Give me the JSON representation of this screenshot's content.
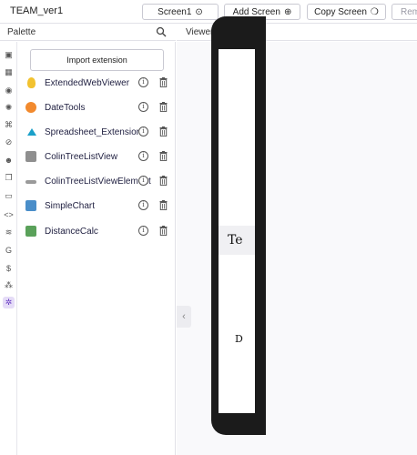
{
  "project": {
    "name": "TEAM_ver1"
  },
  "toolbar": {
    "screen_select": "Screen1",
    "add_screen": "Add Screen",
    "copy_screen": "Copy Screen",
    "remove_screen": "Rem"
  },
  "palette": {
    "title": "Palette",
    "import_label": "Import extension",
    "extensions": [
      {
        "label": "ExtendedWebViewer",
        "icon": "lightbulb-icon",
        "color": "#f2c230"
      },
      {
        "label": "DateTools",
        "icon": "datetools-icon",
        "color": "#f28a2e"
      },
      {
        "label": "Spreadsheet_Extension",
        "icon": "spreadsheet-icon",
        "color": "#1aa0c9"
      },
      {
        "label": "ColinTreeListView",
        "icon": "listview-icon",
        "color": "#8f8f8f"
      },
      {
        "label": "ColinTreeListViewElement",
        "icon": "listview-element-icon",
        "color": "#9a9a9a"
      },
      {
        "label": "SimpleChart",
        "icon": "chart-icon",
        "color": "#4a8ec9"
      },
      {
        "label": "DistanceCalc",
        "icon": "map-icon",
        "color": "#5aa15a"
      }
    ]
  },
  "viewer": {
    "title": "Viewer",
    "screen_text_1": "Te",
    "screen_text_2": "D"
  },
  "colors": {
    "accent": "#6b3fc4",
    "accent_bg": "#e5dcf7"
  }
}
